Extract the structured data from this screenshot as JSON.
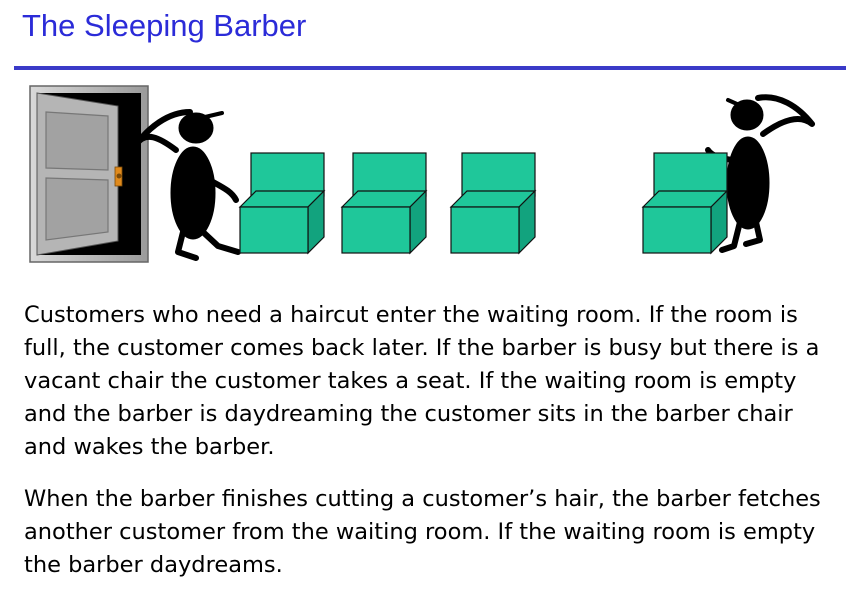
{
  "slide": {
    "title": "The Sleeping Barber",
    "paragraphs": [
      "Customers who need a haircut enter the waiting room. If the room is full, the customer comes back later. If the barber is busy but there is a vacant chair the customer takes a seat. If the waiting room is empty and the barber is daydreaming the customer sits in the barber chair and wakes the barber.",
      "When the barber finishes cutting a customer’s hair, the barber fetches another customer from the waiting room. If the waiting room is empty the barber daydreams."
    ]
  },
  "illustration": {
    "chair_color": "#1fc79a",
    "title_color": "#2b2bd8",
    "items": [
      "door-icon",
      "customer-figure-icon",
      "waiting-chair-icon",
      "waiting-chair-icon",
      "waiting-chair-icon",
      "barber-chair-icon",
      "barber-figure-icon"
    ]
  }
}
